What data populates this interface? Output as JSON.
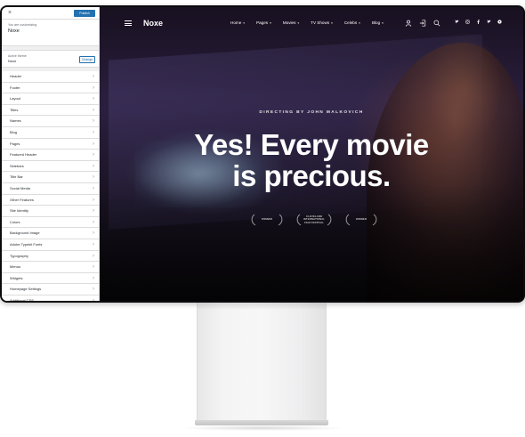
{
  "customizer": {
    "publish_label": "Publish",
    "customizing_label": "You are customizing",
    "site_name": "Noxe",
    "active_theme_label": "Active theme",
    "active_theme_name": "Noxe",
    "change_label": "Change",
    "sections": [
      "Header",
      "Footer",
      "Layout",
      "Titles",
      "Names",
      "Blog",
      "Pages",
      "Featured Header",
      "Sidebars",
      "Title Bar",
      "Social Media",
      "Other Features",
      "Site Identity",
      "Colors",
      "Background Image",
      "Adobe Typekit Fonts",
      "Typography",
      "Menus",
      "Widgets",
      "Homepage Settings",
      "Additional CSS"
    ]
  },
  "site": {
    "logo": "Noxe",
    "menu": [
      "Home",
      "Pages",
      "Movies",
      "TV Shows",
      "Celebs",
      "Blog"
    ],
    "icons": [
      "user-icon",
      "sign-in-icon",
      "search-icon"
    ],
    "socials": [
      "twitter-icon",
      "instagram-icon",
      "facebook-icon",
      "twitter-icon",
      "youtube-icon"
    ],
    "hero": {
      "eyebrow": "DIRECTING BY JOHN MALKOVICH",
      "headline_line1": "Yes! Every movie",
      "headline_line2": "is precious."
    },
    "awards": [
      {
        "line1": "WINNER",
        "line2": ""
      },
      {
        "line1": "CLEVELAND",
        "line2": "INTERNATIONAL",
        "line3": "FILM FESTIVAL"
      },
      {
        "line1": "WINNER",
        "line2": ""
      }
    ]
  },
  "colors": {
    "publish_blue": "#2271b1",
    "hero_text": "#ffffff"
  }
}
